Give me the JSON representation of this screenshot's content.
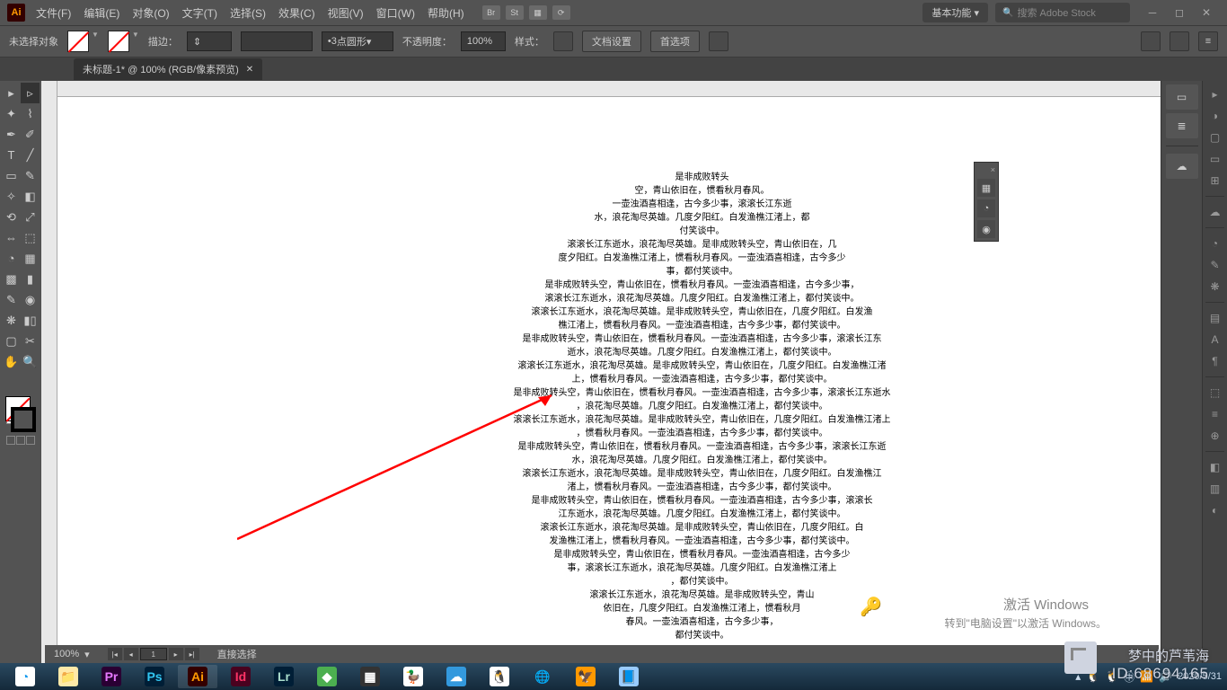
{
  "menubar": {
    "items": [
      "文件(F)",
      "编辑(E)",
      "对象(O)",
      "文字(T)",
      "选择(S)",
      "效果(C)",
      "视图(V)",
      "窗口(W)",
      "帮助(H)"
    ],
    "basic_functions": "基本功能",
    "search_placeholder": "搜索 Adobe Stock"
  },
  "optbar": {
    "no_selection": "未选择对象",
    "stroke_label": "描边",
    "stroke_num": "3",
    "stroke_style": "点圆形",
    "opacity_label": "不透明度",
    "opacity_value": "100%",
    "style_label": "样式",
    "doc_setup": "文档设置",
    "preferences": "首选项"
  },
  "tab": {
    "title": "未标题-1* @ 100% (RGB/像素预览)"
  },
  "status": {
    "zoom": "100%",
    "page": "1",
    "mode": "直接选择"
  },
  "poem": {
    "lines": [
      "是非成败转头",
      "空，青山依旧在，惯看秋月春风。",
      "一壶浊酒喜相逢，古今多少事，滚滚长江东逝",
      "水，浪花淘尽英雄。几度夕阳红。白发渔樵江渚上，都",
      "付笑谈中。",
      "滚滚长江东逝水，浪花淘尽英雄。是非成败转头空，青山依旧在，几",
      "度夕阳红。白发渔樵江渚上，惯看秋月春风。一壶浊酒喜相逢，古今多少",
      "事，都付笑谈中。",
      "是非成败转头空，青山依旧在，惯看秋月春风。一壶浊酒喜相逢，古今多少事，",
      "滚滚长江东逝水，浪花淘尽英雄。几度夕阳红。白发渔樵江渚上，都付笑谈中。",
      "滚滚长江东逝水，浪花淘尽英雄。是非成败转头空，青山依旧在，几度夕阳红。白发渔",
      "樵江渚上，惯看秋月春风。一壶浊酒喜相逢，古今多少事，都付笑谈中。",
      "是非成败转头空，青山依旧在，惯看秋月春风。一壶浊酒喜相逢，古今多少事，滚滚长江东",
      "逝水，浪花淘尽英雄。几度夕阳红。白发渔樵江渚上，都付笑谈中。",
      "滚滚长江东逝水，浪花淘尽英雄。是非成败转头空，青山依旧在，几度夕阳红。白发渔樵江渚",
      "上，惯看秋月春风。一壶浊酒喜相逢，古今多少事，都付笑谈中。",
      "是非成败转头空，青山依旧在，惯看秋月春风。一壶浊酒喜相逢，古今多少事，滚滚长江东逝水",
      "，浪花淘尽英雄。几度夕阳红。白发渔樵江渚上，都付笑谈中。",
      "滚滚长江东逝水，浪花淘尽英雄。是非成败转头空，青山依旧在，几度夕阳红。白发渔樵江渚上",
      "，惯看秋月春风。一壶浊酒喜相逢，古今多少事，都付笑谈中。",
      "是非成败转头空，青山依旧在，惯看秋月春风。一壶浊酒喜相逢，古今多少事，滚滚长江东逝",
      "水，浪花淘尽英雄。几度夕阳红。白发渔樵江渚上，都付笑谈中。",
      "滚滚长江东逝水，浪花淘尽英雄。是非成败转头空，青山依旧在，几度夕阳红。白发渔樵江",
      "渚上，惯看秋月春风。一壶浊酒喜相逢，古今多少事，都付笑谈中。",
      "是非成败转头空，青山依旧在，惯看秋月春风。一壶浊酒喜相逢，古今多少事，滚滚长",
      "江东逝水，浪花淘尽英雄。几度夕阳红。白发渔樵江渚上，都付笑谈中。",
      "滚滚长江东逝水，浪花淘尽英雄。是非成败转头空，青山依旧在，几度夕阳红。白",
      "发渔樵江渚上，惯看秋月春风。一壶浊酒喜相逢，古今多少事，都付笑谈中。",
      "是非成败转头空，青山依旧在，惯看秋月春风。一壶浊酒喜相逢，古今多少",
      "事，滚滚长江东逝水，浪花淘尽英雄。几度夕阳红。白发渔樵江渚上",
      "，都付笑谈中。",
      "滚滚长江东逝水，浪花淘尽英雄。是非成败转头空，青山",
      "依旧在，几度夕阳红。白发渔樵江渚上，惯看秋月",
      "春风。一壶浊酒喜相逢，古今多少事，",
      "都付笑谈中。"
    ]
  },
  "watermark": {
    "l1": "激活 Windows",
    "l2": "转到\"电脑设置\"以激活 Windows。",
    "id_top": "梦中的芦苇海",
    "id": "ID:68694165"
  },
  "taskbar": {
    "time": "2020/5/31"
  }
}
